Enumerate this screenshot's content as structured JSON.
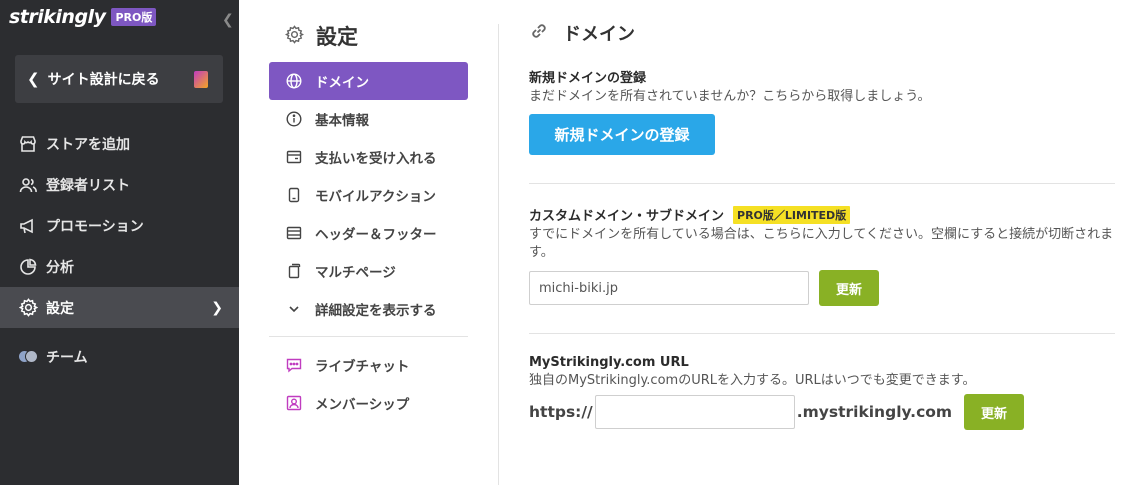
{
  "brand": {
    "logo": "strikingly",
    "plan_badge": "PRO版",
    "accent": "#7e57c2"
  },
  "sidebar": {
    "back_label": "サイト設計に戻る",
    "items": [
      {
        "label": "ストアを追加",
        "icon": "store-icon"
      },
      {
        "label": "登録者リスト",
        "icon": "users-icon"
      },
      {
        "label": "プロモーション",
        "icon": "megaphone-icon"
      },
      {
        "label": "分析",
        "icon": "chart-pie-icon"
      },
      {
        "label": "設定",
        "icon": "gear-icon",
        "active": true
      },
      {
        "label": "チーム",
        "icon": "team-avatar"
      }
    ]
  },
  "settings_menu": {
    "title": "設定",
    "items": [
      {
        "label": "ドメイン",
        "icon": "globe-icon",
        "active": true
      },
      {
        "label": "基本情報",
        "icon": "info-icon"
      },
      {
        "label": "支払いを受け入れる",
        "icon": "payment-icon"
      },
      {
        "label": "モバイルアクション",
        "icon": "mobile-icon"
      },
      {
        "label": "ヘッダー＆フッター",
        "icon": "header-footer-icon"
      },
      {
        "label": "マルチページ",
        "icon": "pages-icon"
      },
      {
        "label": "詳細設定を表示する",
        "icon": "chevron-down-icon"
      }
    ],
    "extra_items": [
      {
        "label": "ライブチャット",
        "icon": "chat-icon"
      },
      {
        "label": "メンバーシップ",
        "icon": "membership-icon"
      }
    ]
  },
  "main": {
    "title": "ドメイン",
    "new_domain": {
      "heading": "新規ドメインの登録",
      "description": "まだドメインを所有されていませんか？こちらから取得しましょう。",
      "button": "新規ドメインの登録"
    },
    "custom_domain": {
      "heading": "カスタムドメイン・サブドメイン",
      "badge": "PRO版／LIMITED版",
      "description": "すでにドメインを所有している場合は、こちらに入力してください。空欄にすると接続が切断されます。",
      "input_value": "michi-biki.jp",
      "button": "更新"
    },
    "mystrikingly": {
      "heading": "MyStrikingly.com URL",
      "description": "独自のMyStrikingly.comのURLを入力する。URLはいつでも変更できます。",
      "prefix": "https://",
      "input_value": "",
      "suffix": ".mystrikingly.com",
      "button": "更新"
    }
  },
  "colors": {
    "sidebar_bg": "#2c2d30",
    "primary_blue": "#2aa7e8",
    "update_green": "#89b125",
    "badge_yellow": "#f5e024"
  }
}
